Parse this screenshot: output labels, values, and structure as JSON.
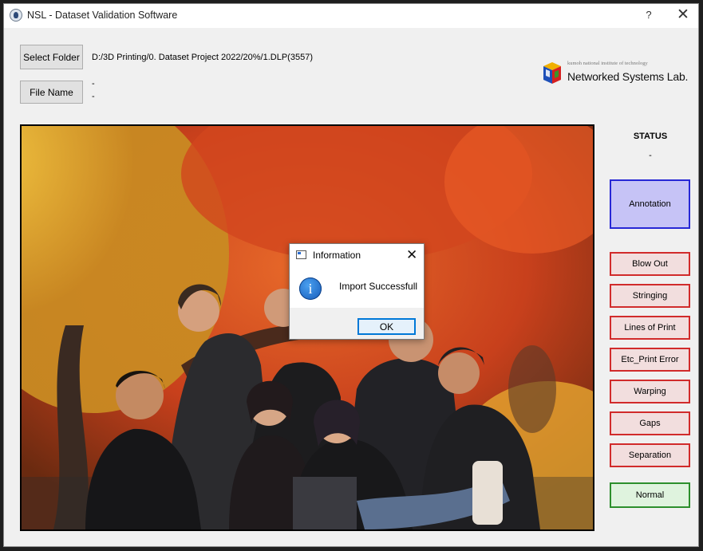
{
  "window": {
    "title": "NSL - Dataset Validation Software",
    "help": "?",
    "close": "✕"
  },
  "controls": {
    "select_folder_label": "Select Folder",
    "folder_path": "D:/3D Printing/0. Dataset Project 2022/20%/1.DLP(3557)",
    "file_name_label": "File Name",
    "file_name_line1": "-",
    "file_name_line2": "-"
  },
  "logo": {
    "small_text": "kumoh national institute of technology",
    "main_text": "Networked Systems Lab."
  },
  "status": {
    "label": "STATUS",
    "value": "-"
  },
  "annotation_button": "Annotation",
  "error_buttons": [
    "Blow Out",
    "Stringing",
    "Lines of Print",
    "Etc_Print Error",
    "Warping",
    "Gaps",
    "Separation"
  ],
  "normal_button": "Normal",
  "dialog": {
    "title": "Information",
    "message": "Import Successfull",
    "ok": "OK",
    "close": "✕",
    "icon_glyph": "i"
  },
  "colors": {
    "annotation_bg": "#c6c3f6",
    "annotation_border": "#2727d6",
    "error_border": "#d12b2b",
    "normal_border": "#2c8f2c"
  }
}
